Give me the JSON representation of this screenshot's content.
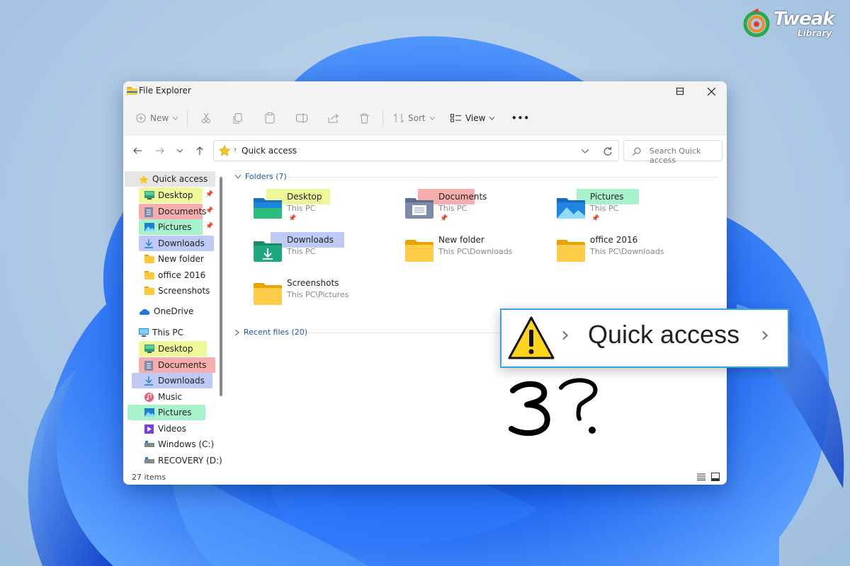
{
  "brand": {
    "name": "Tweak",
    "sub": "Library"
  },
  "window": {
    "title": "File Explorer",
    "controls": {
      "minimize": "—",
      "maximize": "☐",
      "close": "✕"
    }
  },
  "toolbar": {
    "new_label": "New",
    "sort_label": "Sort",
    "view_label": "View",
    "more_label": "•••"
  },
  "address": {
    "location": "Quick access",
    "search_placeholder": "Search Quick access"
  },
  "sidebar": {
    "quick_access": "Quick access",
    "quick_items": [
      {
        "label": "Desktop",
        "icon": "desktop-icon",
        "highlight": "#ecf78e"
      },
      {
        "label": "Documents",
        "icon": "documents-icon",
        "highlight": "#f4a4a4"
      },
      {
        "label": "Pictures",
        "icon": "pictures-icon",
        "highlight": "#9ff2c7"
      },
      {
        "label": "Downloads",
        "icon": "downloads-icon",
        "highlight": "#b7c3f3"
      },
      {
        "label": "New folder",
        "icon": "folder-icon"
      },
      {
        "label": "office 2016",
        "icon": "folder-icon"
      },
      {
        "label": "Screenshots",
        "icon": "folder-icon"
      }
    ],
    "onedrive": "OneDrive",
    "this_pc": "This PC",
    "pc_items": [
      {
        "label": "Desktop",
        "icon": "desktop-icon",
        "highlight": "#ecf78e"
      },
      {
        "label": "Documents",
        "icon": "documents-icon",
        "highlight": "#f4a4a4"
      },
      {
        "label": "Downloads",
        "icon": "downloads-icon",
        "highlight": "#b7c3f3"
      },
      {
        "label": "Music",
        "icon": "music-icon"
      },
      {
        "label": "Pictures",
        "icon": "pictures-icon",
        "highlight": "#9ff2c7"
      },
      {
        "label": "Videos",
        "icon": "videos-icon"
      },
      {
        "label": "Windows (C:)",
        "icon": "drive-icon"
      },
      {
        "label": "RECOVERY (D:)",
        "icon": "drive-icon"
      }
    ]
  },
  "content": {
    "folders_header": "Folders (7)",
    "folders": [
      {
        "name": "Desktop",
        "location": "This PC",
        "pinned": true,
        "icon": "desktop-folder-icon",
        "highlight": "#ecf78e"
      },
      {
        "name": "Documents",
        "location": "This PC",
        "pinned": true,
        "icon": "documents-folder-icon",
        "highlight": "#f4a4a4"
      },
      {
        "name": "Pictures",
        "location": "This PC",
        "pinned": true,
        "icon": "pictures-folder-icon",
        "highlight": "#9ff2c7"
      },
      {
        "name": "Downloads",
        "location": "This PC",
        "pinned": false,
        "icon": "downloads-folder-icon",
        "highlight": "#b7c3f3"
      },
      {
        "name": "New folder",
        "location": "This PC\\Downloads",
        "pinned": false,
        "icon": "folder-icon"
      },
      {
        "name": "office 2016",
        "location": "This PC\\Downloads",
        "pinned": false,
        "icon": "folder-icon"
      },
      {
        "name": "Screenshots",
        "location": "This PC\\Pictures",
        "pinned": false,
        "icon": "folder-icon"
      }
    ],
    "recent_header": "Recent files (20)"
  },
  "status": {
    "items_count": "27 items"
  },
  "callout": {
    "text": "Quick access",
    "icon": "warning-icon"
  },
  "annotation": {
    "text": "3?"
  }
}
